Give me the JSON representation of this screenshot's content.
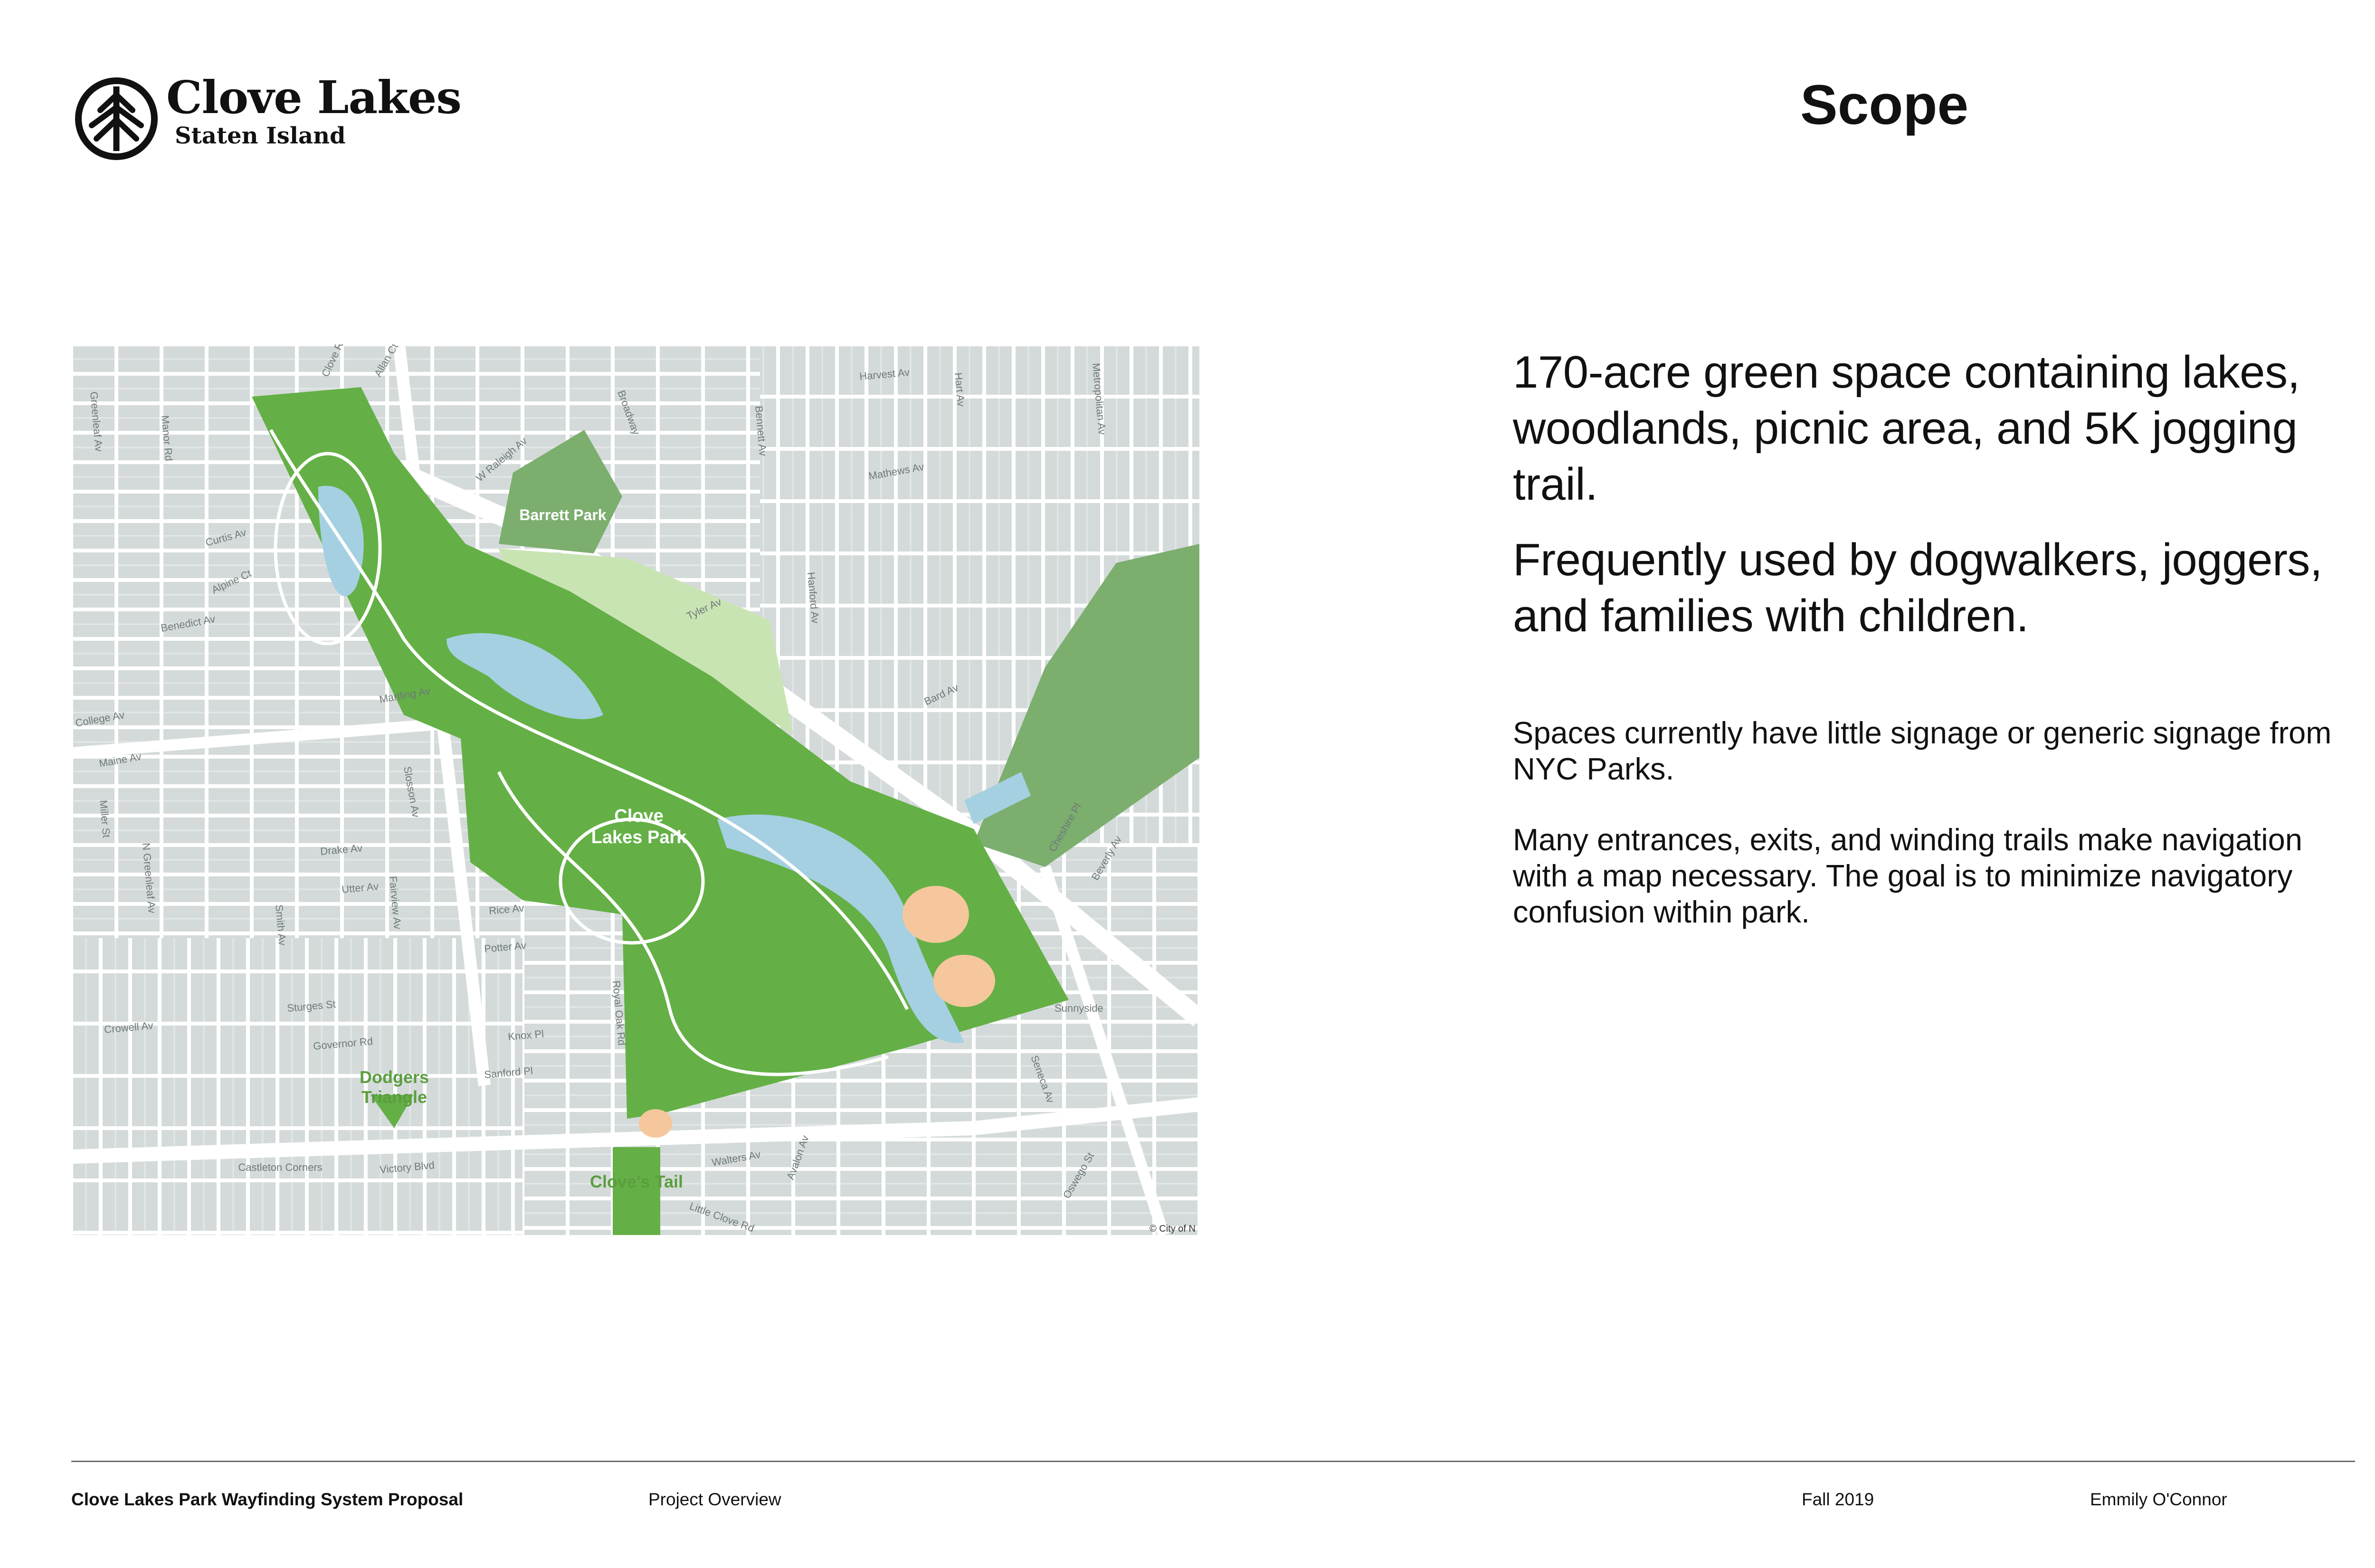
{
  "header": {
    "logo_title": "Clove Lakes",
    "logo_subtitle": "Staten Island",
    "logo_icon": "tree-in-circle-icon",
    "page_title": "Scope"
  },
  "content": {
    "lead_1": "170-acre green space containing lakes, woodlands, picnic area, and 5K jogging trail.",
    "lead_2": "Frequently used by dogwalkers, joggers, and families with children.",
    "body_1": "Spaces currently have little signage or generic signage from NYC Parks.",
    "body_2": "Many entrances, exits, and winding trails make navigation with a map necessary. The goal is to minimize navigatory confusion within park."
  },
  "map": {
    "park_labels": [
      "Clove",
      "Lakes Park",
      "Barrett Park",
      "Dodgers",
      "Triangle",
      "Clove's Tail",
      "Sunnyside"
    ],
    "street_labels": [
      "Clove Rd",
      "Allan Ct",
      "Harvest Av",
      "Hart Av",
      "Metropolitan Av",
      "Greenleaf Av",
      "Manor Rd",
      "W Raleigh Av",
      "Broadway",
      "Bennett Av",
      "Mathews Av",
      "Curtis Av",
      "Alpine Ct",
      "Benedict Av",
      "Hanford Av",
      "Tyler Av",
      "Bard Av",
      "College Av",
      "Martling Av",
      "Slosson Av",
      "Maine Av",
      "Miller St",
      "N Greenleaf Av",
      "Drake Av",
      "Utter Av",
      "Fairview Av",
      "Cheshire Pl",
      "Beverly Av",
      "Rice Av",
      "Potter Av",
      "Royal Oak Rd",
      "Victory Blvd",
      "Sturges St",
      "Knox Pl",
      "Crowell Av",
      "Governor Rd",
      "Sanford Pl",
      "Seneca Av",
      "Walters Av",
      "Little Clove Rd",
      "Avalon Av",
      "Oswego St",
      "Smith Av",
      "Castleton Corners"
    ],
    "attribution": "© City of N"
  },
  "footer": {
    "project": "Clove Lakes Park Wayfinding System Proposal",
    "section": "Project Overview",
    "date": "Fall 2019",
    "author": "Emmily O'Connor"
  },
  "colors": {
    "park_green": "#64b046",
    "park_dark": "#7cae6e",
    "park_light": "#c9e4b3",
    "water": "#a5d0e1",
    "urban": "#d6dcdc",
    "block": "#cfd5d5",
    "street": "#ffffff",
    "ballfield": "#f6c79c",
    "footer_rule": "#6b6b6b"
  }
}
